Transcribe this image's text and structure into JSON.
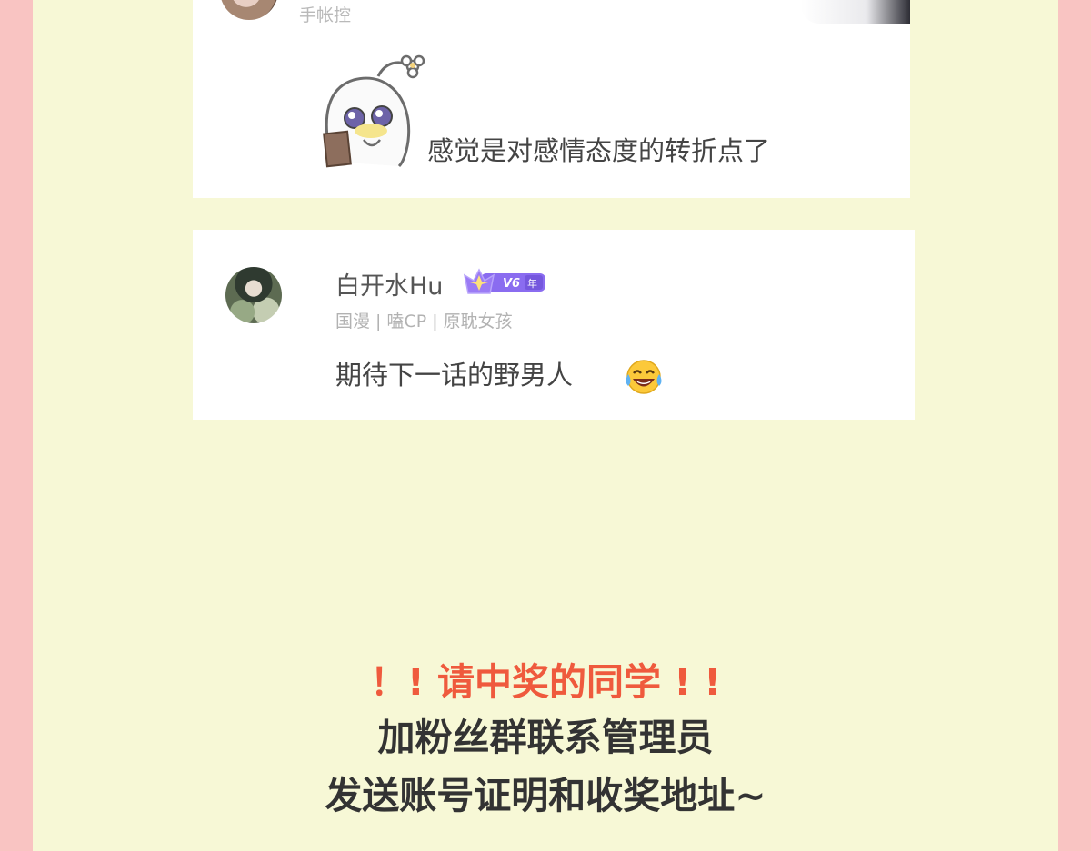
{
  "comment1": {
    "user_tag": "手帐控",
    "text": "感觉是对感情态度的转折点了",
    "avatar_icon": "avatar-image",
    "sticker_icon": "crying-ghost-sticker"
  },
  "comment2": {
    "username": "白开水Hu",
    "vip_label": "V6",
    "vip_year": "年",
    "user_tag": "国漫 | 嗑CP | 原耽女孩",
    "text": "期待下一话的野男人",
    "emoji_icon": "laughing-tears-emoji",
    "avatar_icon": "avatar-image"
  },
  "announcement": {
    "line1": "！! 请中奖的同学 ! !",
    "line2": "加粉丝群联系管理员",
    "line3": "发送账号证明和收奖地址~"
  },
  "colors": {
    "background_border": "#f9c4c2",
    "panel": "#f7f8d6",
    "highlight_red": "#ef5a3d",
    "text_dark": "#333333",
    "vip_purple": "#8a6cf0"
  }
}
